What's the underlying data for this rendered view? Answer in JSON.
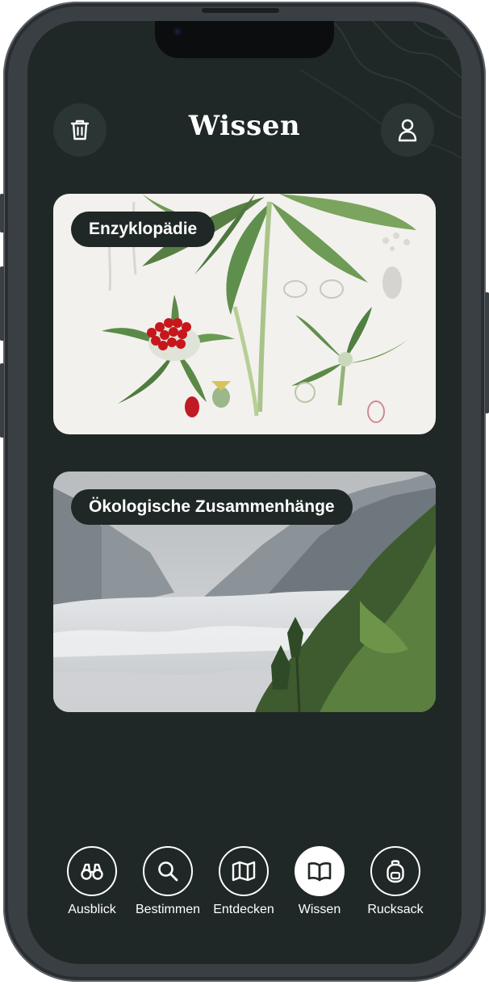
{
  "header": {
    "title": "Wissen",
    "left_icon": "trash-icon",
    "right_icon": "user-icon"
  },
  "cards": [
    {
      "label": "Enzyklopädie",
      "image": "botanical-illustration"
    },
    {
      "label": "Ökologische Zusammenhänge",
      "image": "mountain-cloud-landscape"
    }
  ],
  "nav": {
    "items": [
      {
        "label": "Ausblick",
        "icon": "binoculars-icon",
        "active": false
      },
      {
        "label": "Bestimmen",
        "icon": "search-icon",
        "active": false
      },
      {
        "label": "Entdecken",
        "icon": "map-icon",
        "active": false
      },
      {
        "label": "Wissen",
        "icon": "book-icon",
        "active": true
      },
      {
        "label": "Rucksack",
        "icon": "backpack-icon",
        "active": false
      }
    ]
  },
  "colors": {
    "screen_bg": "#1f2826",
    "button_bg": "#2b3533",
    "text": "#ffffff"
  }
}
